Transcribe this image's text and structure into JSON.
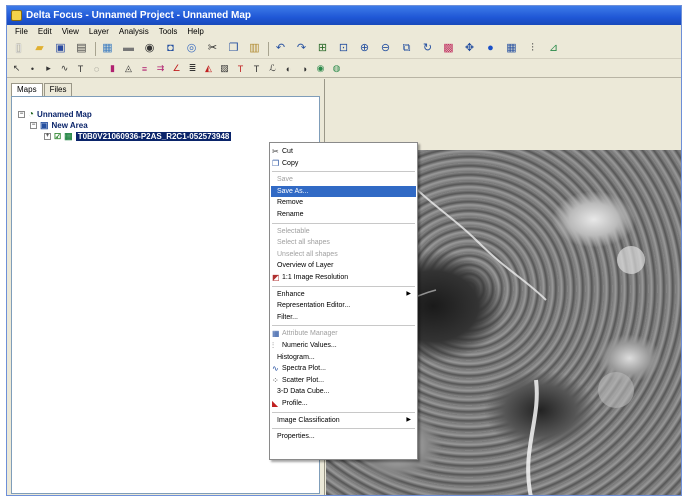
{
  "window": {
    "title": "Delta Focus - Unnamed Project - Unnamed Map"
  },
  "menubar": [
    "File",
    "Edit",
    "View",
    "Layer",
    "Analysis",
    "Tools",
    "Help"
  ],
  "tabs": [
    {
      "label": "Maps",
      "active": true
    },
    {
      "label": "Files",
      "active": false
    }
  ],
  "tree": {
    "map_name": "Unnamed Map",
    "area_name": "New Area",
    "layer_name": "T0B0V21060936-P2AS_R2C1-052573948"
  },
  "context_menu": {
    "items": [
      {
        "label": "Cut",
        "state": "normal",
        "icon": "scissors-icon"
      },
      {
        "label": "Copy",
        "state": "normal",
        "icon": "copy-icon"
      },
      {
        "separator": true
      },
      {
        "label": "Save",
        "state": "disabled"
      },
      {
        "label": "Save As...",
        "state": "selected"
      },
      {
        "label": "Remove",
        "state": "normal"
      },
      {
        "label": "Rename",
        "state": "normal"
      },
      {
        "separator": true
      },
      {
        "label": "Selectable",
        "state": "disabled"
      },
      {
        "label": "Select all shapes",
        "state": "disabled"
      },
      {
        "label": "Unselect all shapes",
        "state": "disabled"
      },
      {
        "label": "Overview of Layer",
        "state": "normal"
      },
      {
        "label": "1:1 Image Resolution",
        "state": "normal",
        "icon": "resolution-icon"
      },
      {
        "separator": true
      },
      {
        "label": "Enhance",
        "state": "normal",
        "submenu": true
      },
      {
        "label": "Representation Editor...",
        "state": "normal"
      },
      {
        "label": "Filter...",
        "state": "normal"
      },
      {
        "separator": true
      },
      {
        "label": "Attribute Manager",
        "state": "disabled",
        "icon": "table-icon"
      },
      {
        "label": "Numeric Values...",
        "state": "normal",
        "icon": "numeric-icon"
      },
      {
        "label": "Histogram...",
        "state": "normal"
      },
      {
        "label": "Spectra Plot...",
        "state": "normal",
        "icon": "spectra-icon"
      },
      {
        "label": "Scatter Plot...",
        "state": "normal",
        "icon": "scatter-icon"
      },
      {
        "label": "3-D Data Cube...",
        "state": "normal"
      },
      {
        "label": "Profile...",
        "state": "normal",
        "icon": "profile-icon"
      },
      {
        "separator": true
      },
      {
        "label": "Image Classification",
        "state": "normal",
        "submenu": true
      },
      {
        "separator": true
      },
      {
        "label": "Properties...",
        "state": "normal"
      }
    ]
  },
  "colors": {
    "selection": "#316ac5",
    "titlebar": "#1f57d6",
    "layer_highlight": "#0a246a"
  }
}
